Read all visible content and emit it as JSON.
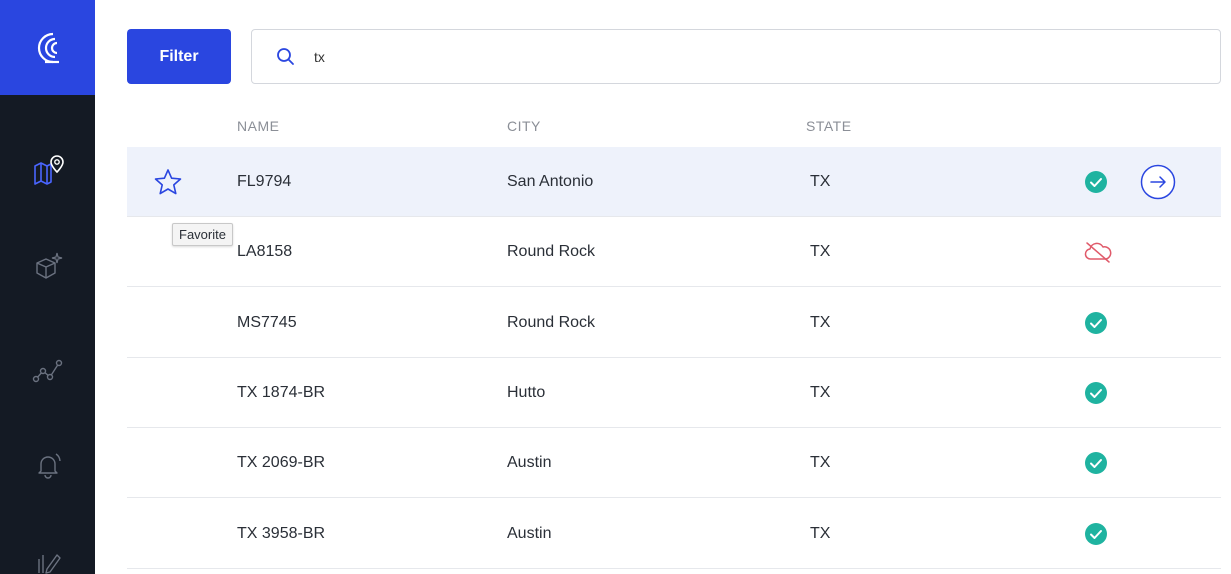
{
  "app": {
    "logo": "brand-logo-icon"
  },
  "sidebar": {
    "items": [
      {
        "icon": "map-pin-icon",
        "active": true
      },
      {
        "icon": "cube-sparkle-icon",
        "active": false
      },
      {
        "icon": "analytics-line-icon",
        "active": false
      },
      {
        "icon": "bell-icon",
        "active": false
      },
      {
        "icon": "edit-icon",
        "active": false
      }
    ]
  },
  "toolbar": {
    "filter_label": "Filter",
    "search_value": "tx",
    "search_placeholder": ""
  },
  "table": {
    "columns": [
      "NAME",
      "CITY",
      "STATE"
    ],
    "rows": [
      {
        "name": "FL9794",
        "city": "San Antonio",
        "state": "TX",
        "status": "online"
      },
      {
        "name": "LA8158",
        "city": "Round Rock",
        "state": "TX",
        "status": "offline"
      },
      {
        "name": "MS7745",
        "city": "Round Rock",
        "state": "TX",
        "status": "online"
      },
      {
        "name": "TX 1874-BR",
        "city": "Hutto",
        "state": "TX",
        "status": "online"
      },
      {
        "name": "TX 2069-BR",
        "city": "Austin",
        "state": "TX",
        "status": "online"
      },
      {
        "name": "TX 3958-BR",
        "city": "Austin",
        "state": "TX",
        "status": "online"
      }
    ]
  },
  "tooltip": {
    "text": "Favorite"
  },
  "colors": {
    "accent": "#2a46e0",
    "sidebar": "#141a24",
    "ok": "#1fb3a0",
    "error": "#e05a6a",
    "row_highlight": "#eef2fb"
  }
}
